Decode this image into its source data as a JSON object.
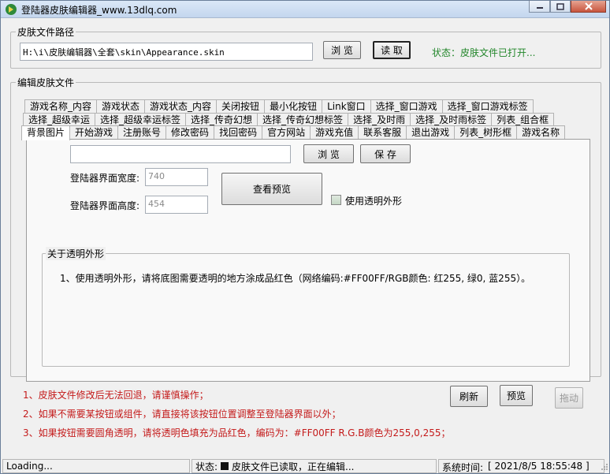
{
  "window": {
    "title": "登陆器皮肤编辑器_www.13dlq.com"
  },
  "file_path_group": {
    "title": "皮肤文件路径",
    "path_value": "H:\\i\\皮肤编辑器\\全套\\skin\\Appearance.skin",
    "browse_label": "浏 览",
    "read_label": "读 取",
    "status_text": "状态：皮肤文件已打开..."
  },
  "edit_group": {
    "title": "编辑皮肤文件",
    "tabs_row1": [
      "游戏名称_内容",
      "游戏状态",
      "游戏状态_内容",
      "关闭按钮",
      "最小化按钮",
      "Link窗口",
      "选择_窗口游戏",
      "选择_窗口游戏标签"
    ],
    "tabs_row2": [
      "选择_超级幸运",
      "选择_超级幸运标签",
      "选择_传奇幻想",
      "选择_传奇幻想标签",
      "选择_及时雨",
      "选择_及时雨标签",
      "列表_组合框"
    ],
    "tabs_row3": [
      "背景图片",
      "开始游戏",
      "注册账号",
      "修改密码",
      "找回密码",
      "官方网站",
      "游戏充值",
      "联系客服",
      "退出游戏",
      "列表_树形框",
      "游戏名称"
    ],
    "active_tab": "背景图片",
    "panel": {
      "image_path_value": "",
      "browse_label": "浏 览",
      "save_label": "保 存",
      "width_label": "登陆器界面宽度:",
      "width_value": "740",
      "height_label": "登陆器界面高度:",
      "height_value": "454",
      "preview_label": "查看预览",
      "transparent_label": "使用透明外形",
      "transparent_checked": false,
      "about_title": "关于透明外形",
      "about_text": "1、使用透明外形，请将底图需要透明的地方涂成品红色（网络编码:#FF00FF/RGB颜色: 红255, 绿0, 蓝255）。"
    }
  },
  "notes": [
    "1、皮肤文件修改后无法回退，请谨慎操作；",
    "2、如果不需要某按钮或组件，请直接将该按钮位置调整至登陆器界面以外；",
    "3、如果按钮需要圆角透明，请将透明色填充为品红色，编码为：#FF00FF R.G.B颜色为255,0,255；"
  ],
  "actions": {
    "refresh_label": "刷新",
    "preview_label": "预览",
    "drag_label": "拖动"
  },
  "statusbar": {
    "loading": "Loading...",
    "status_label": "状态:",
    "status_text": "皮肤文件已读取，正在编辑...",
    "time_label": "系统时间:",
    "time_value": "[ 2021/8/5 18:55:48 ]"
  },
  "colors": {
    "status_green": "#22862a",
    "note_red": "#c41a1a"
  }
}
